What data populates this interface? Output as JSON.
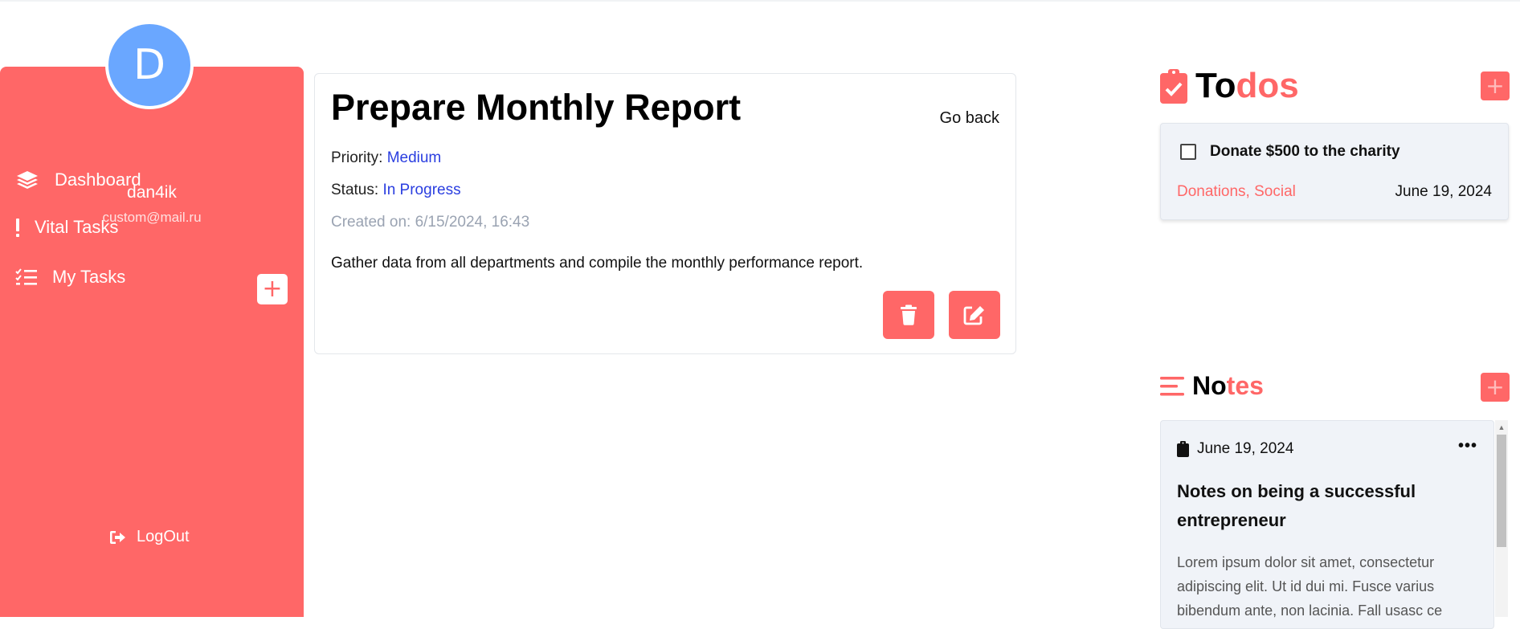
{
  "colors": {
    "accent": "#ff6767",
    "link": "#2a3ee0",
    "avatar": "#6aa7ff",
    "muted": "#9aa3b2"
  },
  "user": {
    "initial": "D",
    "name": "dan4ik",
    "email": "custom@mail.ru"
  },
  "sidebar": {
    "items": [
      {
        "label": "Dashboard",
        "icon": "layers-icon"
      },
      {
        "label": "Vital Tasks",
        "icon": "exclamation-icon"
      },
      {
        "label": "My Tasks",
        "icon": "task-list-icon"
      }
    ],
    "add_label": "+",
    "logout_label": "LogOut"
  },
  "task": {
    "title": "Prepare Monthly Report",
    "go_back": "Go back",
    "priority_label": "Priority:",
    "priority_value": "Medium",
    "status_label": "Status:",
    "status_value": "In Progress",
    "created": "Created on: 6/15/2024, 16:43",
    "description": "Gather data from all departments and compile the monthly performance report."
  },
  "todos": {
    "title_dark": "To",
    "title_accent": "dos",
    "add_label": "+",
    "items": [
      {
        "title": "Donate $500 to the charity",
        "tags": "Donations, Social",
        "date": "June 19, 2024"
      }
    ]
  },
  "notes": {
    "title_dark": "No",
    "title_accent": "tes",
    "add_label": "+",
    "items": [
      {
        "date": "June 19, 2024",
        "more": "•••",
        "title": "Notes on being a successful entrepreneur",
        "body": "Lorem ipsum dolor sit amet, consectetur adipiscing elit. Ut id dui mi. Fusce varius bibendum ante, non lacinia. Fall usasc ce"
      }
    ]
  }
}
